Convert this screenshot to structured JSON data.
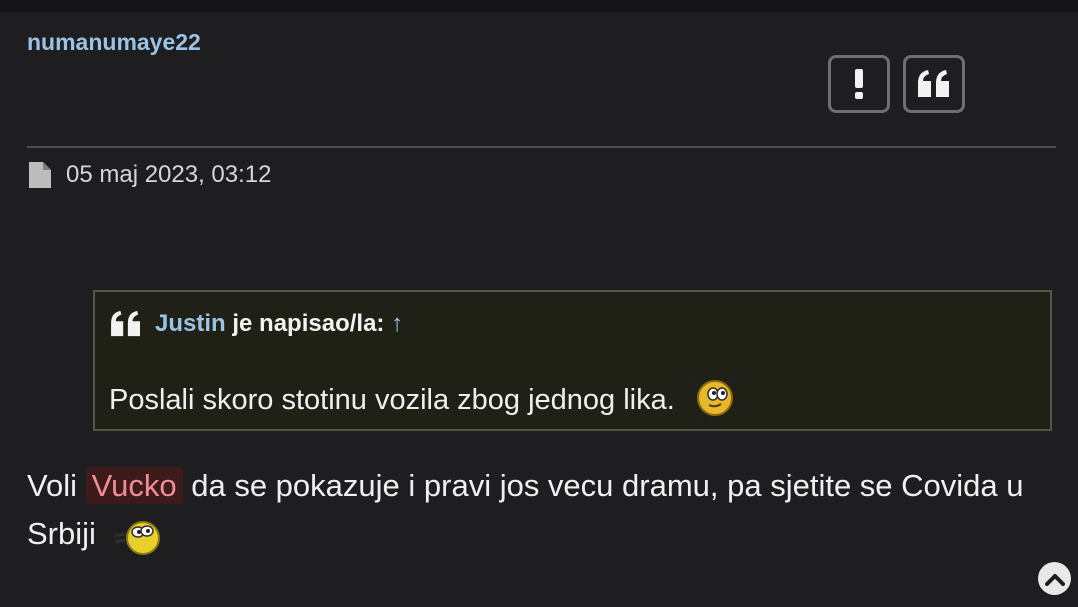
{
  "post": {
    "username": "numanumaye22",
    "date": "05 maj 2023, 03:12"
  },
  "actions": {
    "report_icon": "exclamation-icon",
    "quote_icon": "quote-icon"
  },
  "quote": {
    "author": "Justin",
    "suffix": "je napisao/la:",
    "arrow": "↑",
    "text": "Poslali skoro stotinu vozila zbog jednog lika."
  },
  "body": {
    "before_mention": "Voli ",
    "mention": "Vucko",
    "after_mention": " da se pokazuje i pravi jos vecu dramu, pa sjetite se Covida u Srbiji"
  },
  "colors": {
    "background": "#1e1e21",
    "username": "#9cc3e6",
    "mention_bg": "#3d1b1b",
    "mention_text": "#f08e96",
    "quote_bg": "#1f2016"
  }
}
